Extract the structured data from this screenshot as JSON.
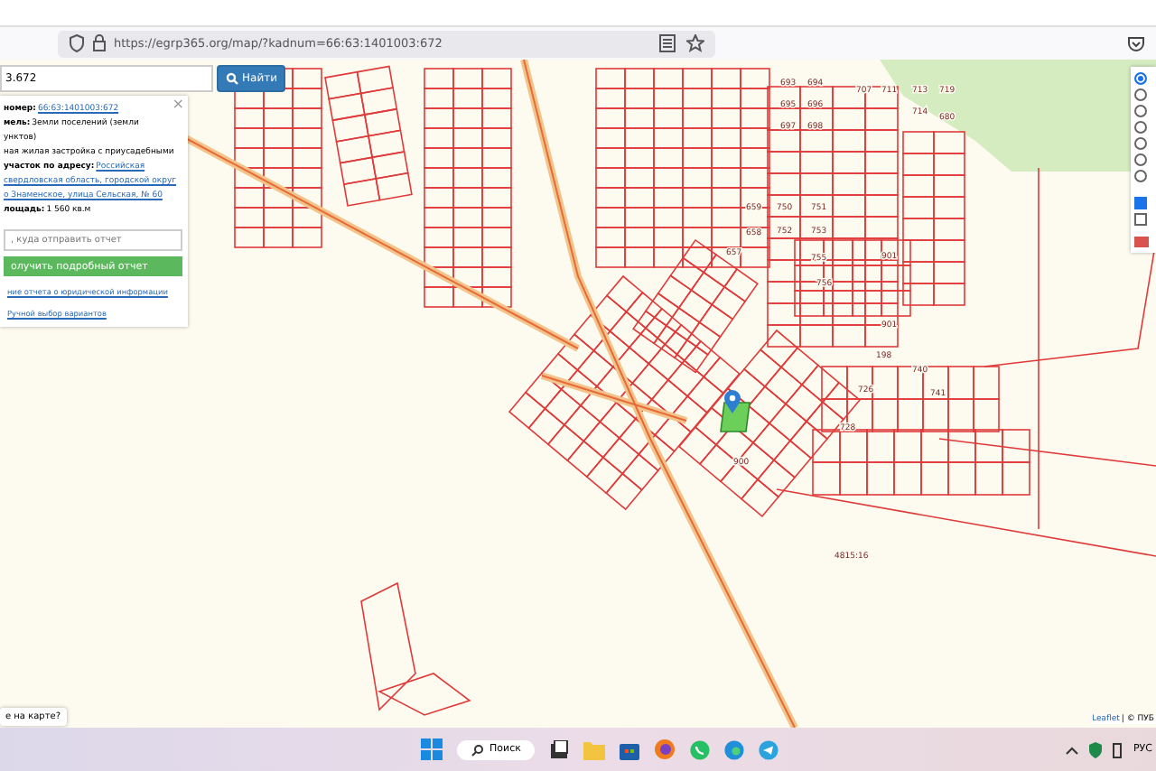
{
  "browser": {
    "url": "https://egrp365.org/map/?kadnum=66:63:1401003:672"
  },
  "search": {
    "value": "3.672",
    "button": "Найти"
  },
  "info_panel": {
    "close": "×",
    "lines": [
      {
        "label": "номер:",
        "link": "66:63:1401003:672"
      },
      {
        "label": "мель:",
        "text": "Земли поселений (земли"
      },
      {
        "text": "унктов)"
      },
      {
        "text": "ная жилая застройка с приусадебными"
      },
      {
        "label": "участок по адресу:",
        "link": "Российская"
      },
      {
        "link": "свердловская область, городской округ"
      },
      {
        "link": "о Знаменское, улица Сельская, № 60"
      },
      {
        "label": "лощадь:",
        "text": "1 560 кв.м"
      }
    ],
    "email_placeholder": ", куда отправить отчет",
    "report_button": "олучить подробный отчет",
    "links": [
      "ние отчета о юридической информации",
      "Ручной выбор вариантов"
    ]
  },
  "layers_panel": {
    "radios": [
      {
        "selected": true
      },
      {
        "selected": false
      },
      {
        "selected": false
      },
      {
        "selected": false
      },
      {
        "selected": false
      },
      {
        "selected": false
      },
      {
        "selected": false
      }
    ],
    "checkboxes": [
      {
        "checked": true
      },
      {
        "checked": false
      }
    ]
  },
  "map": {
    "parcel_labels": [
      "901",
      "901",
      "900",
      "198",
      "4815:16",
      "750",
      "751",
      "752",
      "753",
      "755",
      "756",
      "693",
      "694",
      "695",
      "696",
      "697",
      "698",
      "707",
      "711",
      "713",
      "714",
      "719",
      "680",
      "659",
      "658",
      "657",
      "728",
      "726",
      "741",
      "740"
    ],
    "question": "е на карте?",
    "attribution_link": "Leaflet",
    "attribution": "| © ПУБ"
  },
  "taskbar": {
    "search": "Поиск",
    "language": "РУС"
  }
}
